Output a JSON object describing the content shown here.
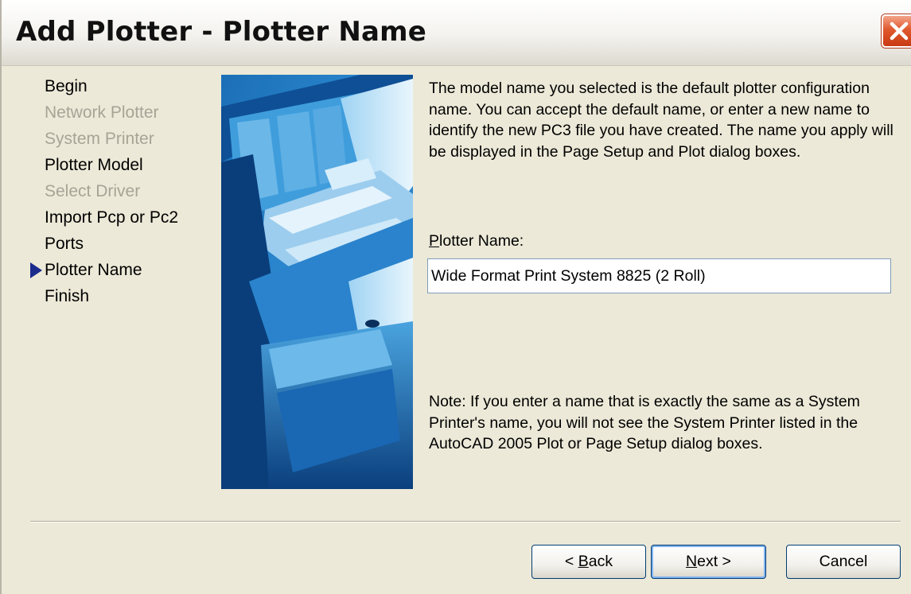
{
  "window": {
    "title": "Add Plotter - Plotter Name"
  },
  "steps": [
    {
      "label": "Begin",
      "state": "enabled"
    },
    {
      "label": "Network Plotter",
      "state": "disabled"
    },
    {
      "label": "System Printer",
      "state": "disabled"
    },
    {
      "label": "Plotter Model",
      "state": "enabled"
    },
    {
      "label": "Select Driver",
      "state": "disabled"
    },
    {
      "label": "Import Pcp or Pc2",
      "state": "enabled"
    },
    {
      "label": "Ports",
      "state": "enabled"
    },
    {
      "label": "Plotter Name",
      "state": "current"
    },
    {
      "label": "Finish",
      "state": "enabled"
    }
  ],
  "main": {
    "description": "The model name you selected is the default plotter configuration name. You can accept the default name, or enter a new name to identify the new PC3 file you have created. The name you apply will be displayed in the Page Setup and Plot dialog boxes.",
    "plotter_name_label_mnemonic": "P",
    "plotter_name_label_rest": "lotter Name:",
    "plotter_name_value": "Wide Format Print System 8825 (2 Roll)",
    "note": "Note: If you enter a name that is exactly the same as a System Printer's name, you will not see the System Printer listed in the AutoCAD 2005 Plot or Page Setup dialog boxes."
  },
  "buttons": {
    "back_prefix": "< ",
    "back_mnemonic": "B",
    "back_rest": "ack",
    "next_mnemonic": "N",
    "next_rest": "ext >",
    "cancel": "Cancel"
  },
  "colors": {
    "dialog_bg": "#ece9d8",
    "disabled_text": "#a6a497",
    "current_step_arrow": "#1a2b8c",
    "close_button": "#e0592e"
  },
  "icons": {
    "close": "close-x-icon",
    "current_step": "current-step-arrow-icon"
  }
}
